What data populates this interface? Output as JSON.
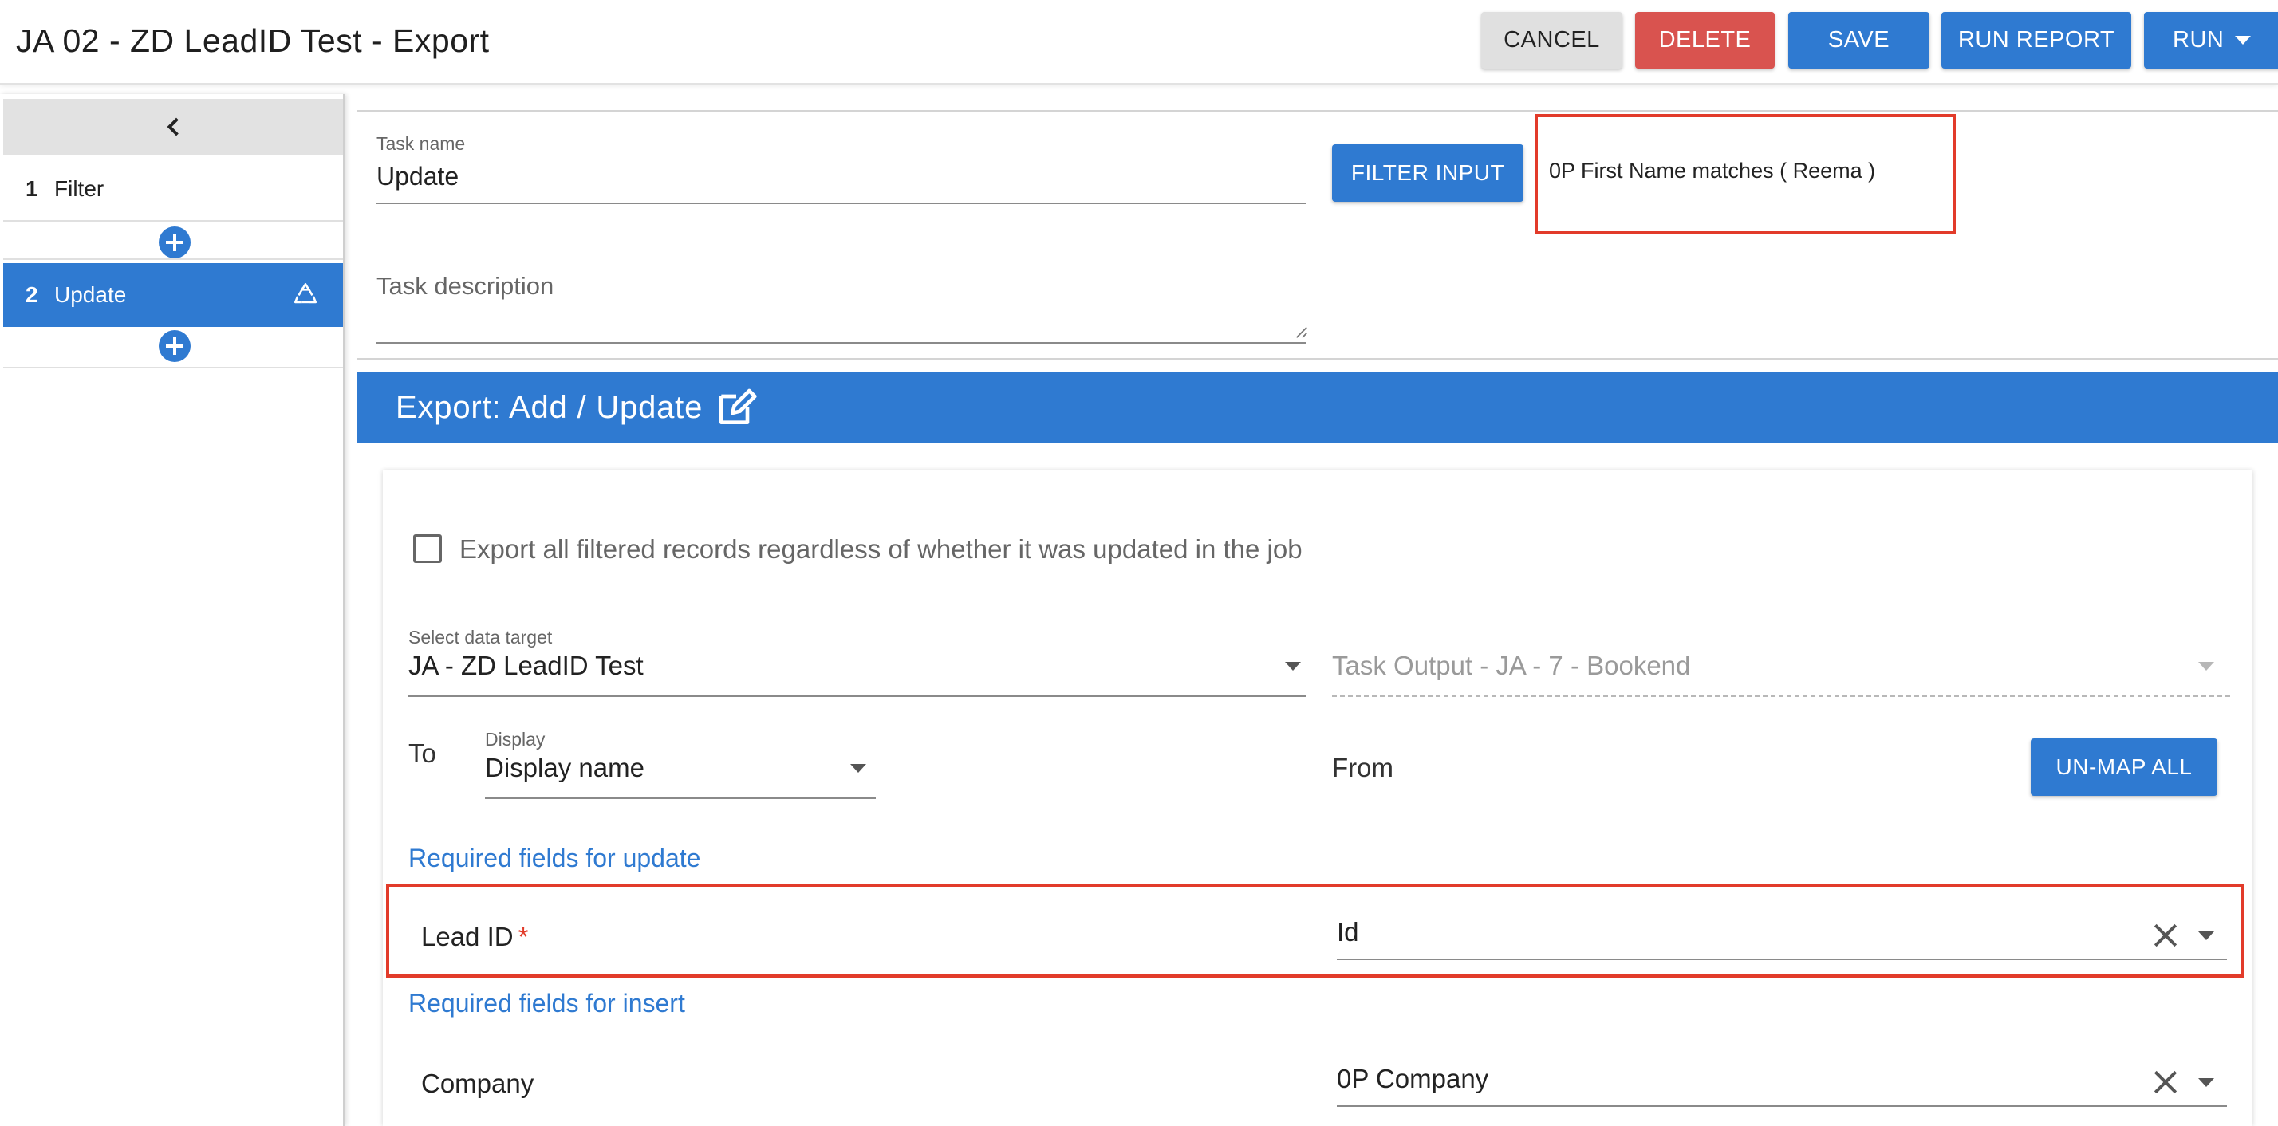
{
  "header": {
    "title": "JA 02 - ZD LeadID Test - Export",
    "buttons": {
      "cancel": "CANCEL",
      "delete": "DELETE",
      "save": "SAVE",
      "run_report": "RUN REPORT",
      "run": "RUN"
    }
  },
  "sidebar": {
    "steps": [
      {
        "number": "1",
        "label": "Filter"
      },
      {
        "number": "2",
        "label": "Update"
      }
    ]
  },
  "task": {
    "name_label": "Task name",
    "name_value": "Update",
    "description_placeholder": "Task description",
    "filter_button": "FILTER INPUT",
    "filter_summary": "0P First Name matches ( Reema )"
  },
  "export": {
    "header_title": "Export: Add / Update",
    "checkbox_label": "Export all filtered records regardless of whether it was updated in the job",
    "checkbox_checked": false,
    "data_target_label": "Select data target",
    "data_target_value": "JA - ZD LeadID Test",
    "task_output_value": "Task Output - JA - 7 - Bookend",
    "to_label": "To",
    "display_label": "Display",
    "display_value": "Display name",
    "from_label": "From",
    "unmap_button": "UN-MAP ALL",
    "required_update_label": "Required fields for update",
    "required_insert_label": "Required fields for insert",
    "mappings": [
      {
        "target": "Lead ID",
        "required": "*",
        "source": "Id"
      },
      {
        "target": "Company",
        "source": "0P Company"
      }
    ]
  },
  "colors": {
    "primary": "#2f7ad1",
    "danger": "#d9534f",
    "highlight_border": "#e23b2a"
  }
}
